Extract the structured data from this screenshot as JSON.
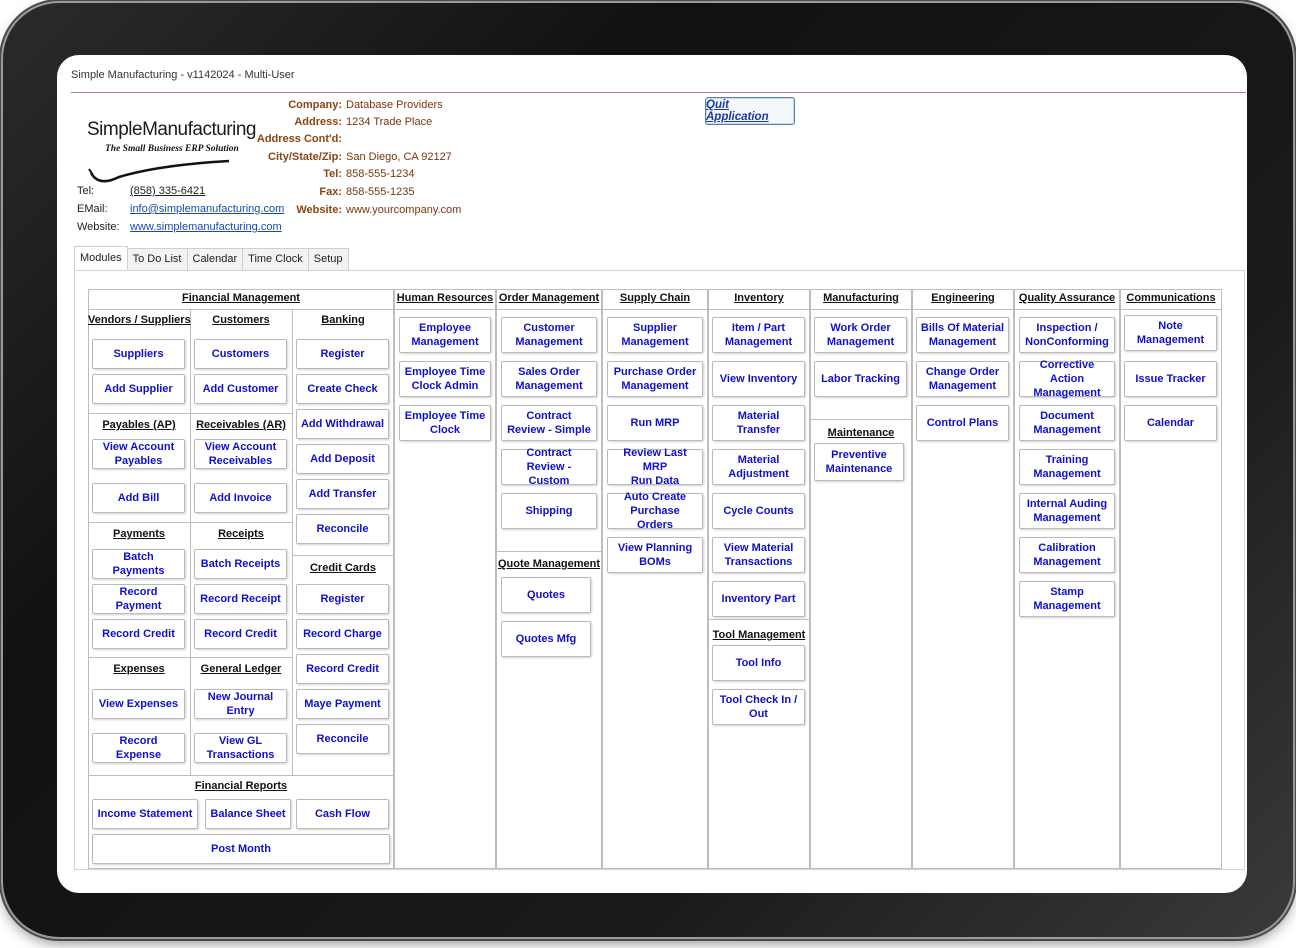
{
  "window": {
    "title": "Simple Manufacturing - v1142024 - Multi-User"
  },
  "logo": {
    "name": "SimpleManufacturing",
    "tagline": "The Small Business ERP Solution"
  },
  "contact": {
    "tel_label": "Tel:",
    "tel": "(858) 335-6421",
    "email_label": "EMail:",
    "email": "info@simplemanufacturing.com",
    "website_label": "Website:",
    "website": "www.simplemanufacturing.com"
  },
  "company": {
    "rows": [
      {
        "label": "Company:",
        "value": "Database Providers"
      },
      {
        "label": "Address:",
        "value": "1234 Trade Place"
      },
      {
        "label": "Address Cont'd:",
        "value": ""
      },
      {
        "label": "City/State/Zip:",
        "value": "San Diego, CA 92127"
      },
      {
        "label": "Tel:",
        "value": "858-555-1234"
      },
      {
        "label": "Fax:",
        "value": "858-555-1235"
      },
      {
        "label": "Website:",
        "value": "www.yourcompany.com"
      }
    ]
  },
  "quit_label": "Quit Application",
  "tabs": [
    "Modules",
    "To Do List",
    "Calendar",
    "Time Clock",
    "Setup"
  ],
  "modules": {
    "financial": {
      "title": "Financial Management",
      "vendors": {
        "title": "Vendors / Suppliers",
        "buttons": [
          "Suppliers",
          "Add Supplier"
        ]
      },
      "customers": {
        "title": "Customers",
        "buttons": [
          "Customers",
          "Add Customer"
        ]
      },
      "banking": {
        "title": "Banking",
        "buttons": [
          "Register",
          "Create Check",
          "Add Withdrawal",
          "Add Deposit",
          "Add Transfer",
          "Reconcile"
        ]
      },
      "payables": {
        "title": "Payables (AP)",
        "buttons": [
          "View Account\nPayables",
          "Add Bill"
        ]
      },
      "receivables": {
        "title": "Receivables (AR)",
        "buttons": [
          "View Account\nReceivables",
          "Add Invoice"
        ]
      },
      "payments": {
        "title": "Payments",
        "buttons": [
          "Batch Payments",
          "Record Payment",
          "Record Credit"
        ]
      },
      "receipts": {
        "title": "Receipts",
        "buttons": [
          "Batch Receipts",
          "Record Receipt",
          "Record Credit"
        ]
      },
      "credit_cards": {
        "title": "Credit Cards",
        "buttons": [
          "Register",
          "Record Charge",
          "Record Credit",
          "Maye Payment",
          "Reconcile"
        ]
      },
      "expenses": {
        "title": "Expenses",
        "buttons": [
          "View Expenses",
          "Record Expense"
        ]
      },
      "general_ledger": {
        "title": "General Ledger",
        "buttons": [
          "New Journal\nEntry",
          "View GL\nTransactions"
        ]
      },
      "reports": {
        "title": "Financial Reports",
        "buttons": [
          "Income Statement",
          "Balance Sheet",
          "Cash Flow",
          "Post Month"
        ]
      }
    },
    "hr": {
      "title": "Human Resources",
      "buttons": [
        "Employee\nManagement",
        "Employee Time\nClock Admin",
        "Employee Time\nClock"
      ]
    },
    "orders": {
      "title": "Order Management",
      "buttons": [
        "Customer\nManagement",
        "Sales Order\nManagement",
        "Contract\nReview - Simple",
        "Contract\nReview - Custom",
        "Shipping"
      ]
    },
    "quotes": {
      "title": "Quote Management",
      "buttons": [
        "Quotes",
        "Quotes Mfg"
      ]
    },
    "supply": {
      "title": "Supply Chain",
      "buttons": [
        "Supplier\nManagement",
        "Purchase Order\nManagement",
        "Run MRP",
        "Review Last MRP\nRun Data",
        "Auto Create\nPurchase Orders",
        "View Planning\nBOMs"
      ]
    },
    "inventory": {
      "title": "Inventory",
      "buttons": [
        "Item / Part\nManagement",
        "View Inventory",
        "Material Transfer",
        "Material\nAdjustment",
        "Cycle Counts",
        "View Material\nTransactions",
        "Inventory Part"
      ]
    },
    "tools": {
      "title": "Tool Management",
      "buttons": [
        "Tool Info",
        "Tool Check In /\nOut"
      ]
    },
    "manufacturing": {
      "title": "Manufacturing",
      "buttons": [
        "Work Order\nManagement",
        "Labor Tracking"
      ]
    },
    "maintenance": {
      "title": "Maintenance",
      "buttons": [
        "Preventive\nMaintenance"
      ]
    },
    "engineering": {
      "title": "Engineering",
      "buttons": [
        "Bills Of Material\nManagement",
        "Change Order\nManagement",
        "Control Plans"
      ]
    },
    "quality": {
      "title": "Quality Assurance",
      "buttons": [
        "Inspection /\nNonConforming",
        "Corrective Action\nManagement",
        "Document\nManagement",
        "Training\nManagement",
        "Internal Auding\nManagement",
        "Calibration\nManagement",
        "Stamp\nManagement"
      ]
    },
    "communications": {
      "title": "Communications",
      "buttons": [
        "Note\nManagement",
        "Issue Tracker",
        "Calendar"
      ]
    }
  }
}
